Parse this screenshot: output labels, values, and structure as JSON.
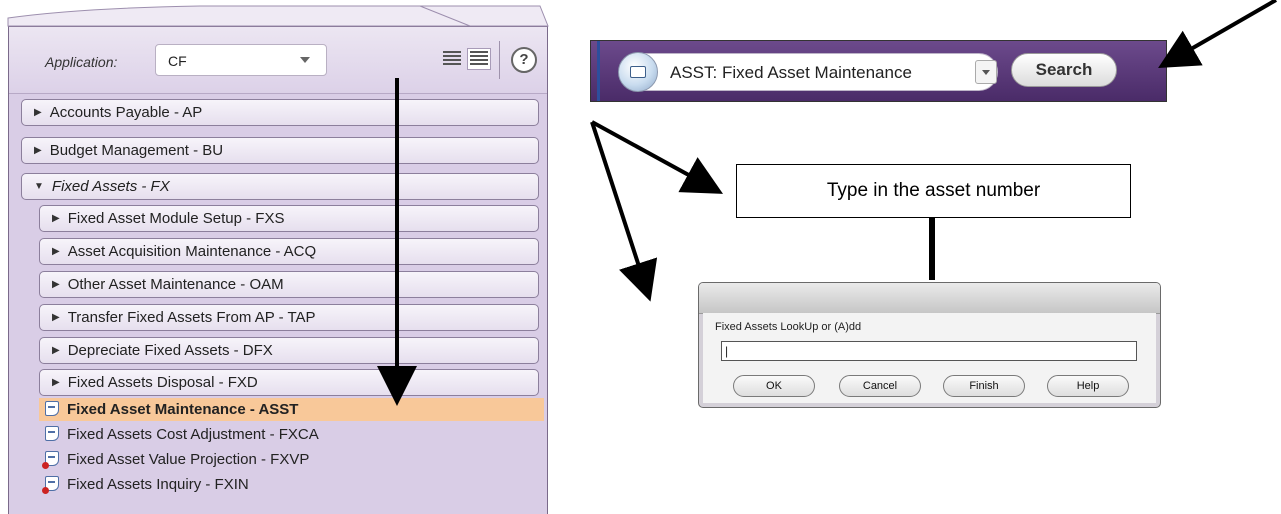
{
  "nav": {
    "app_label": "Application:",
    "app_value": "CF",
    "help": "?",
    "rows": [
      {
        "label": "Accounts Payable - AP",
        "expanded": false
      },
      {
        "label": "Budget Management - BU",
        "expanded": false
      },
      {
        "label": "Fixed Assets - FX",
        "expanded": true
      }
    ],
    "subrows": [
      {
        "label": "Fixed Asset Module Setup - FXS"
      },
      {
        "label": "Asset Acquisition Maintenance - ACQ"
      },
      {
        "label": "Other Asset Maintenance - OAM"
      },
      {
        "label": "Transfer Fixed Assets From AP - TAP"
      },
      {
        "label": "Depreciate Fixed Assets - DFX"
      },
      {
        "label": "Fixed Assets Disposal - FXD"
      }
    ],
    "leaves": [
      {
        "label": "Fixed Asset Maintenance - ASST",
        "selected": true
      },
      {
        "label": "Fixed Assets Cost Adjustment - FXCA",
        "selected": false
      },
      {
        "label": "Fixed Asset Value Projection - FXVP",
        "selected": false
      },
      {
        "label": "Fixed Assets Inquiry - FXIN",
        "selected": false
      }
    ]
  },
  "searchbar": {
    "text": "ASST: Fixed Asset Maintenance",
    "button": "Search"
  },
  "callout": "Type in the asset number",
  "dialog": {
    "prompt": "Fixed Assets LookUp or (A)dd",
    "input_value": "|",
    "buttons": {
      "ok": "OK",
      "cancel": "Cancel",
      "finish": "Finish",
      "help": "Help"
    }
  },
  "colors": {
    "panel": "#d9cde6",
    "selected": "#f8c899",
    "searchbar": "#5a3a7a"
  },
  "icons": [
    "question-icon",
    "list-view-icon",
    "detail-view-icon",
    "document-icon",
    "app-globe-icon",
    "dropdown-caret-icon"
  ]
}
